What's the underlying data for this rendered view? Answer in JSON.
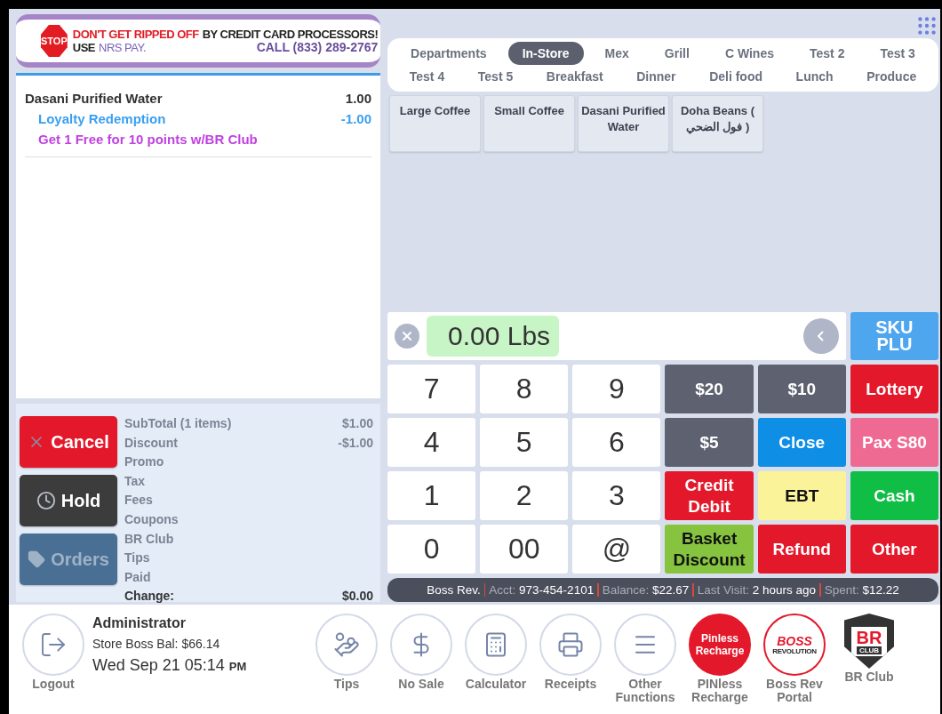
{
  "banner": {
    "stop": "STOP",
    "headline_warning": "DON'T GET RIPPED OFF",
    "headline_rest": "BY CREDIT CARD PROCESSORS!",
    "use": "USE",
    "brand": "NRS PAY.",
    "call": "CALL (833) 289-2767"
  },
  "receipt": {
    "items": [
      {
        "name": "Dasani Purified Water",
        "amount": "1.00",
        "lines": [
          {
            "kind": "discount",
            "text": "Loyalty Redemption",
            "amount": "-1.00"
          },
          {
            "kind": "promo",
            "text": "Get 1 Free for 10 points w/BR Club"
          }
        ]
      }
    ]
  },
  "order_buttons": [
    {
      "kind": "cancel",
      "label": "Cancel",
      "disabled": false
    },
    {
      "kind": "hold",
      "label": "Hold",
      "disabled": false
    },
    {
      "kind": "orders",
      "label": "Orders",
      "disabled": true
    }
  ],
  "totals": [
    {
      "kind": "line",
      "label": "SubTotal (1 items)",
      "value": "$1.00"
    },
    {
      "kind": "line",
      "label": "Discount",
      "value": "-$1.00"
    },
    {
      "kind": "line",
      "label": "Promo"
    },
    {
      "kind": "line",
      "label": "Tax"
    },
    {
      "kind": "line",
      "label": "Fees"
    },
    {
      "kind": "line",
      "label": "Coupons"
    },
    {
      "kind": "line",
      "label": "BR Club"
    },
    {
      "kind": "line",
      "label": "Tips"
    },
    {
      "kind": "line",
      "label": "Paid"
    },
    {
      "kind": "total",
      "label": "Change:",
      "value": "$0.00"
    }
  ],
  "category_rows": [
    [
      {
        "label": "Departments",
        "selected": false
      },
      {
        "label": "In-Store",
        "selected": true
      },
      {
        "label": "Mex",
        "selected": false
      },
      {
        "label": "Grill",
        "selected": false
      },
      {
        "label": "C Wines",
        "selected": false
      },
      {
        "label": "Test 2",
        "selected": false
      },
      {
        "label": "Test 3",
        "selected": false
      }
    ],
    [
      {
        "label": "Test 4",
        "selected": false
      },
      {
        "label": "Test 5",
        "selected": false
      },
      {
        "label": "Breakfast",
        "selected": false
      },
      {
        "label": "Dinner",
        "selected": false
      },
      {
        "label": "Deli food",
        "selected": false
      },
      {
        "label": "Lunch",
        "selected": false
      },
      {
        "label": "Produce",
        "selected": false
      }
    ]
  ],
  "products": [
    "Large Coffee",
    "Small Coffee",
    "Dasani Purified Water",
    "Doha Beans ( فول الضحي )"
  ],
  "entry": {
    "value": "0.00 Lbs",
    "sku_button": "SKU PLU"
  },
  "keypad": [
    {
      "kind": "digit",
      "label": "7"
    },
    {
      "kind": "digit",
      "label": "8"
    },
    {
      "kind": "digit",
      "label": "9"
    },
    {
      "kind": "function",
      "label": "$20",
      "color": "#5d6170"
    },
    {
      "kind": "function",
      "label": "$10",
      "color": "#5d6170"
    },
    {
      "kind": "function",
      "label": "Lottery",
      "color": "#e3192b"
    },
    {
      "kind": "digit",
      "label": "4"
    },
    {
      "kind": "digit",
      "label": "5"
    },
    {
      "kind": "digit",
      "label": "6"
    },
    {
      "kind": "function",
      "label": "$5",
      "color": "#5d6170"
    },
    {
      "kind": "function",
      "label": "Close",
      "color": "#0f8ee6"
    },
    {
      "kind": "function",
      "label": "Pax S80",
      "color": "#ee6a93"
    },
    {
      "kind": "digit",
      "label": "1"
    },
    {
      "kind": "digit",
      "label": "2"
    },
    {
      "kind": "digit",
      "label": "3"
    },
    {
      "kind": "function",
      "label": "Credit Debit",
      "color": "#e3192b"
    },
    {
      "kind": "function",
      "label": "EBT",
      "color": "#fbf39a"
    },
    {
      "kind": "function",
      "label": "Cash",
      "color": "#10bd45"
    },
    {
      "kind": "digit",
      "label": "0"
    },
    {
      "kind": "digit",
      "label": "00"
    },
    {
      "kind": "digit",
      "label": "@"
    },
    {
      "kind": "function",
      "label": "Basket Discount",
      "color": "#86c440"
    },
    {
      "kind": "function",
      "label": "Refund",
      "color": "#e3192b"
    },
    {
      "kind": "function",
      "label": "Other",
      "color": "#e3192b"
    }
  ],
  "customer_bar": [
    {
      "value": "Boss Rev."
    },
    {
      "label": "Acct:",
      "value": "973-454-2101"
    },
    {
      "label": "Balance:",
      "value": "$22.67"
    },
    {
      "label": "Last Visit:",
      "value": "2 hours ago"
    },
    {
      "label": "Spent:",
      "value": "$12.22"
    }
  ],
  "footer": {
    "logout": "Logout",
    "user": "Administrator",
    "store_balance": "Store Boss Bal: $66.14",
    "datetime": "Wed Sep 21 05:14",
    "meridiem": "PM",
    "actions": [
      {
        "kind": "tips",
        "label": "Tips"
      },
      {
        "kind": "nosale",
        "label": "No Sale"
      },
      {
        "kind": "calculator",
        "label": "Calculator"
      },
      {
        "kind": "receipts",
        "label": "Receipts"
      },
      {
        "kind": "menu",
        "label": "Other Functions"
      },
      {
        "kind": "pinless",
        "label": "PINless Recharge",
        "badge": "Pinless Recharge"
      },
      {
        "kind": "boss",
        "label": "Boss Rev Portal",
        "badge": "BOSS",
        "badge_sub": "REVOLUTION"
      },
      {
        "kind": "brclub",
        "label": "BR Club",
        "badge": "BR",
        "badge_sub": "CLUB"
      }
    ]
  }
}
